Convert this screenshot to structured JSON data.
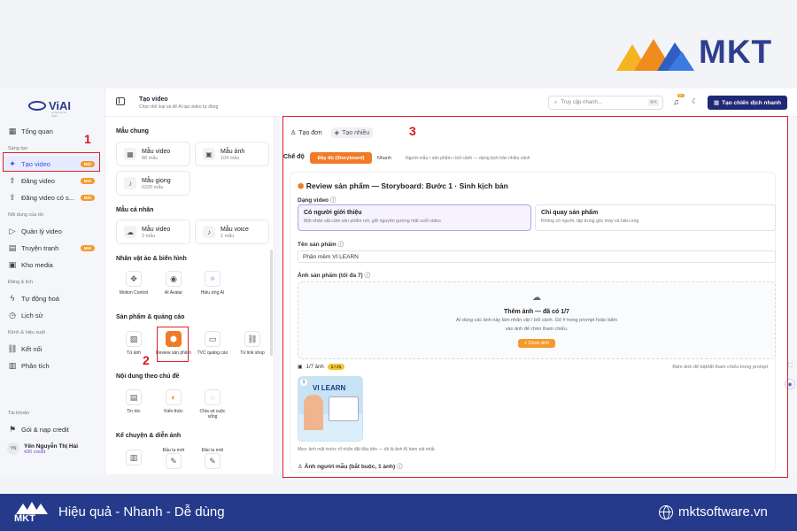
{
  "brand": {
    "name": "MKT",
    "app_name": "ViAI",
    "app_tagline": "AI Agents for Video"
  },
  "colors": {
    "accent": "#f07a25",
    "primary": "#1e2a78",
    "active_nav": "#3655e6",
    "highlight": "#e0202a"
  },
  "sidebar": {
    "overview": "Tổng quan",
    "groups": [
      {
        "heading": "Sáng tạo",
        "items": [
          {
            "label": "Tạo video",
            "badge": "Mới",
            "icon": "sparkle-icon",
            "active": true
          },
          {
            "label": "Đăng video",
            "badge": "Mới",
            "icon": "upload-icon"
          },
          {
            "label": "Đăng video có s...",
            "badge": "Mới",
            "icon": "upload-schedule-icon"
          }
        ]
      },
      {
        "heading": "Nội dung của tôi",
        "items": [
          {
            "label": "Quản lý video",
            "icon": "play-circle-icon"
          },
          {
            "label": "Truyện tranh",
            "badge": "Mới",
            "icon": "book-icon"
          },
          {
            "label": "Kho media",
            "icon": "image-icon"
          }
        ]
      },
      {
        "heading": "Đăng & lịch",
        "items": [
          {
            "label": "Tự động hoá",
            "icon": "bolt-icon"
          },
          {
            "label": "Lịch sử",
            "icon": "clock-icon"
          }
        ]
      },
      {
        "heading": "Kênh & hiệu suất",
        "items": [
          {
            "label": "Kết nối",
            "icon": "link-icon"
          },
          {
            "label": "Phân tích",
            "icon": "chart-icon"
          }
        ]
      },
      {
        "heading": "Tài khoản",
        "items": [
          {
            "label": "Gói & nạp credit",
            "icon": "gift-icon"
          }
        ]
      }
    ],
    "user": {
      "initials": "YN",
      "name": "Yến Nguyễn Thị Hải",
      "credit": "436 credit"
    }
  },
  "header": {
    "title": "Tạo video",
    "subtitle": "Chọn thể loại và để AI tạo video tự động",
    "search_placeholder": "Truy cập nhanh...",
    "search_shortcut": "⌘K",
    "notif_count": "9+",
    "cta_label": "Tạo chiến dịch nhanh"
  },
  "templates": {
    "common_heading": "Mẫu chung",
    "common": [
      {
        "title": "Mẫu video",
        "count": "88 mẫu",
        "icon": "grid-icon"
      },
      {
        "title": "Mẫu ảnh",
        "count": "104 mẫu",
        "icon": "image-icon"
      },
      {
        "title": "Mẫu giọng",
        "count": "6320 mẫu",
        "icon": "mic-icon"
      }
    ],
    "personal_heading": "Mẫu cá nhân",
    "personal": [
      {
        "title": "Mẫu video",
        "count": "3 mẫu",
        "icon": "cloud-upload-icon"
      },
      {
        "title": "Mẫu voice",
        "count": "1 mẫu",
        "icon": "mic-icon"
      }
    ],
    "virtual_heading": "Nhân vật ảo & biến hình",
    "virtual": [
      {
        "label": "Motion Control",
        "icon": "move-icon"
      },
      {
        "label": "AI Avatar",
        "icon": "avatar-icon"
      },
      {
        "label": "Hiệu ứng AI",
        "icon": "effect-icon"
      }
    ],
    "product_heading": "Sản phẩm & quảng cáo",
    "product": [
      {
        "label": "Từ ảnh",
        "icon": "photo-icon"
      },
      {
        "label": "Review sản phẩm",
        "icon": "box-icon",
        "selected": true
      },
      {
        "label": "TVC quảng cáo",
        "icon": "tv-icon"
      },
      {
        "label": "Từ link shop",
        "icon": "link-icon"
      }
    ],
    "topic_heading": "Nội dung theo chủ đề",
    "topic": [
      {
        "label": "Tin tức",
        "icon": "news-icon"
      },
      {
        "label": "Kiến thức",
        "icon": "bulb-icon"
      },
      {
        "label": "Chia sẻ cuộc sống",
        "icon": "chat-icon"
      }
    ],
    "story_heading": "Kể chuyện & diễn ảnh",
    "story": [
      {
        "label": "",
        "icon": "film-icon"
      },
      {
        "label": "Đấu tu mới",
        "icon": "edit-icon"
      },
      {
        "label": "Đảo tu mới",
        "icon": "edit-icon"
      }
    ]
  },
  "main": {
    "mode_tabs": [
      {
        "label": "Tạo đơn",
        "icon": "user-icon",
        "active": true
      },
      {
        "label": "Tạo nhiều",
        "icon": "layers-icon"
      }
    ],
    "mode_label": "Chế độ",
    "mode_on": "Đầy đủ (Storyboard)",
    "mode_off": "Nhanh",
    "mode_hint": "Người mẫu • sản phẩm • bối cảnh — dựng kịch bản nhiều cảnh",
    "section_title": "Review sản phẩm — Storyboard: Bước 1 · Sinh kịch bản",
    "video_type_label": "Dạng video",
    "options": [
      {
        "title": "Có người giới thiệu",
        "desc": "Một nhân vật cầm sản phẩm nói, giữ nguyên gương mặt suốt video",
        "selected": true
      },
      {
        "title": "Chỉ quay sản phẩm",
        "desc": "Không có người, tập trung góc máy và hiệu ứng"
      }
    ],
    "product_name_label": "Tên sản phẩm",
    "product_name_value": "Phần mềm VI LEARN",
    "product_image_label": "Ảnh sản phẩm (tối đa 7)",
    "upload_title": "Thêm ảnh — đã có 1/7",
    "upload_desc_1": "AI dùng các ảnh này làm nhân vật / bối cảnh. Gõ # trong prompt hoặc bấm",
    "upload_desc_2": "vào ảnh để chèn tham chiếu.",
    "upload_button": "+ Chọn ảnh",
    "image_count": "1/7 ảnh",
    "image_count_tag": "1 • #1",
    "image_hint": "Bấm ảnh để bật/tắt tham chiếu trong prompt",
    "thumb_index": "1",
    "thumb_text": "VI LEARN",
    "tip": "Mẹo: ảnh mặt trước rõ nhãn đặt đầu tiên — đó là ảnh AI bám sát nhất.",
    "model_image_label": "Ảnh người mẫu (bắt buộc, 1 ảnh)"
  },
  "annotations": {
    "one": "1",
    "two": "2",
    "three": "3"
  },
  "footer": {
    "logo": "MKT",
    "slogan": "Hiệu quả - Nhanh - Dễ dùng",
    "website": "mktsoftware.vn"
  }
}
